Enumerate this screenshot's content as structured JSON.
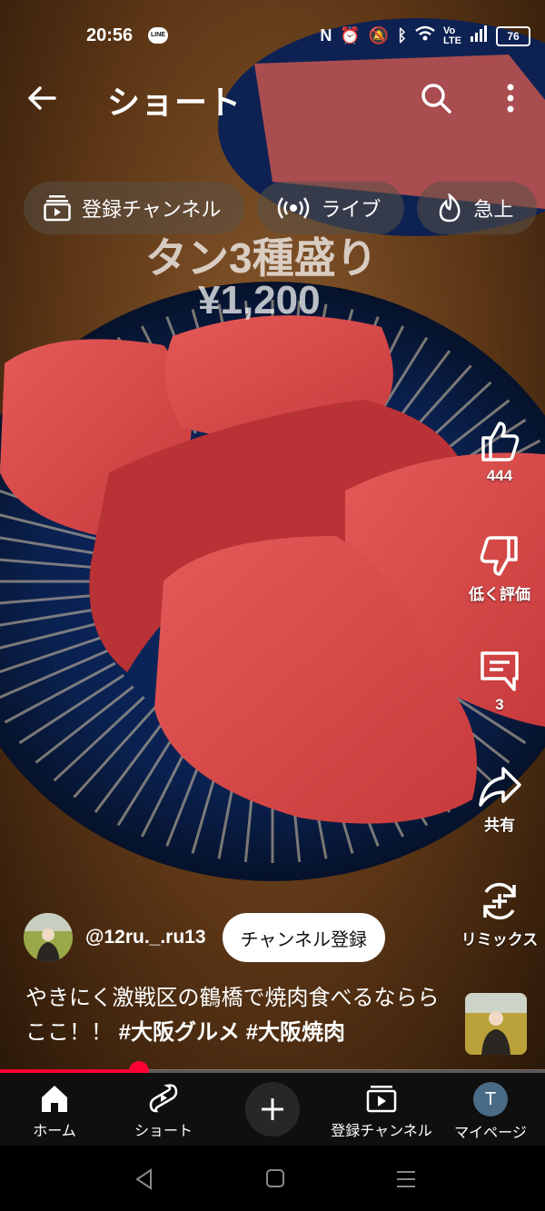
{
  "status_bar": {
    "time": "20:56",
    "line_badge": "LINE",
    "battery": "76"
  },
  "header": {
    "title": "ショート"
  },
  "chips": [
    {
      "label": "登録チャンネル",
      "icon": "subscriptions-icon"
    },
    {
      "label": "ライブ",
      "icon": "live-icon"
    },
    {
      "label": "急上",
      "icon": "trending-flame-icon"
    }
  ],
  "video": {
    "caption_line1": "タン3種盛り",
    "caption_line2": "¥1,200"
  },
  "actions": {
    "like_count": "444",
    "dislike_label": "低く評価",
    "comment_count": "3",
    "share_label": "共有",
    "remix_label": "リミックス"
  },
  "channel": {
    "handle": "@12ru._.ru13",
    "subscribe_label": "チャンネル登録"
  },
  "description": {
    "text": "やきにく激戦区の鶴橋で焼肉食べるなららここ！！",
    "hashtag1": "#大阪グルメ",
    "hashtag2": "#大阪焼肉"
  },
  "progress": {
    "fraction": 0.255
  },
  "bottom_nav": {
    "home": "ホーム",
    "shorts": "ショート",
    "subscriptions": "登録チャンネル",
    "me": "マイページ",
    "me_initial": "T"
  },
  "colors": {
    "accent": "#ff0033",
    "nav_bg": "#0f0f0f"
  }
}
